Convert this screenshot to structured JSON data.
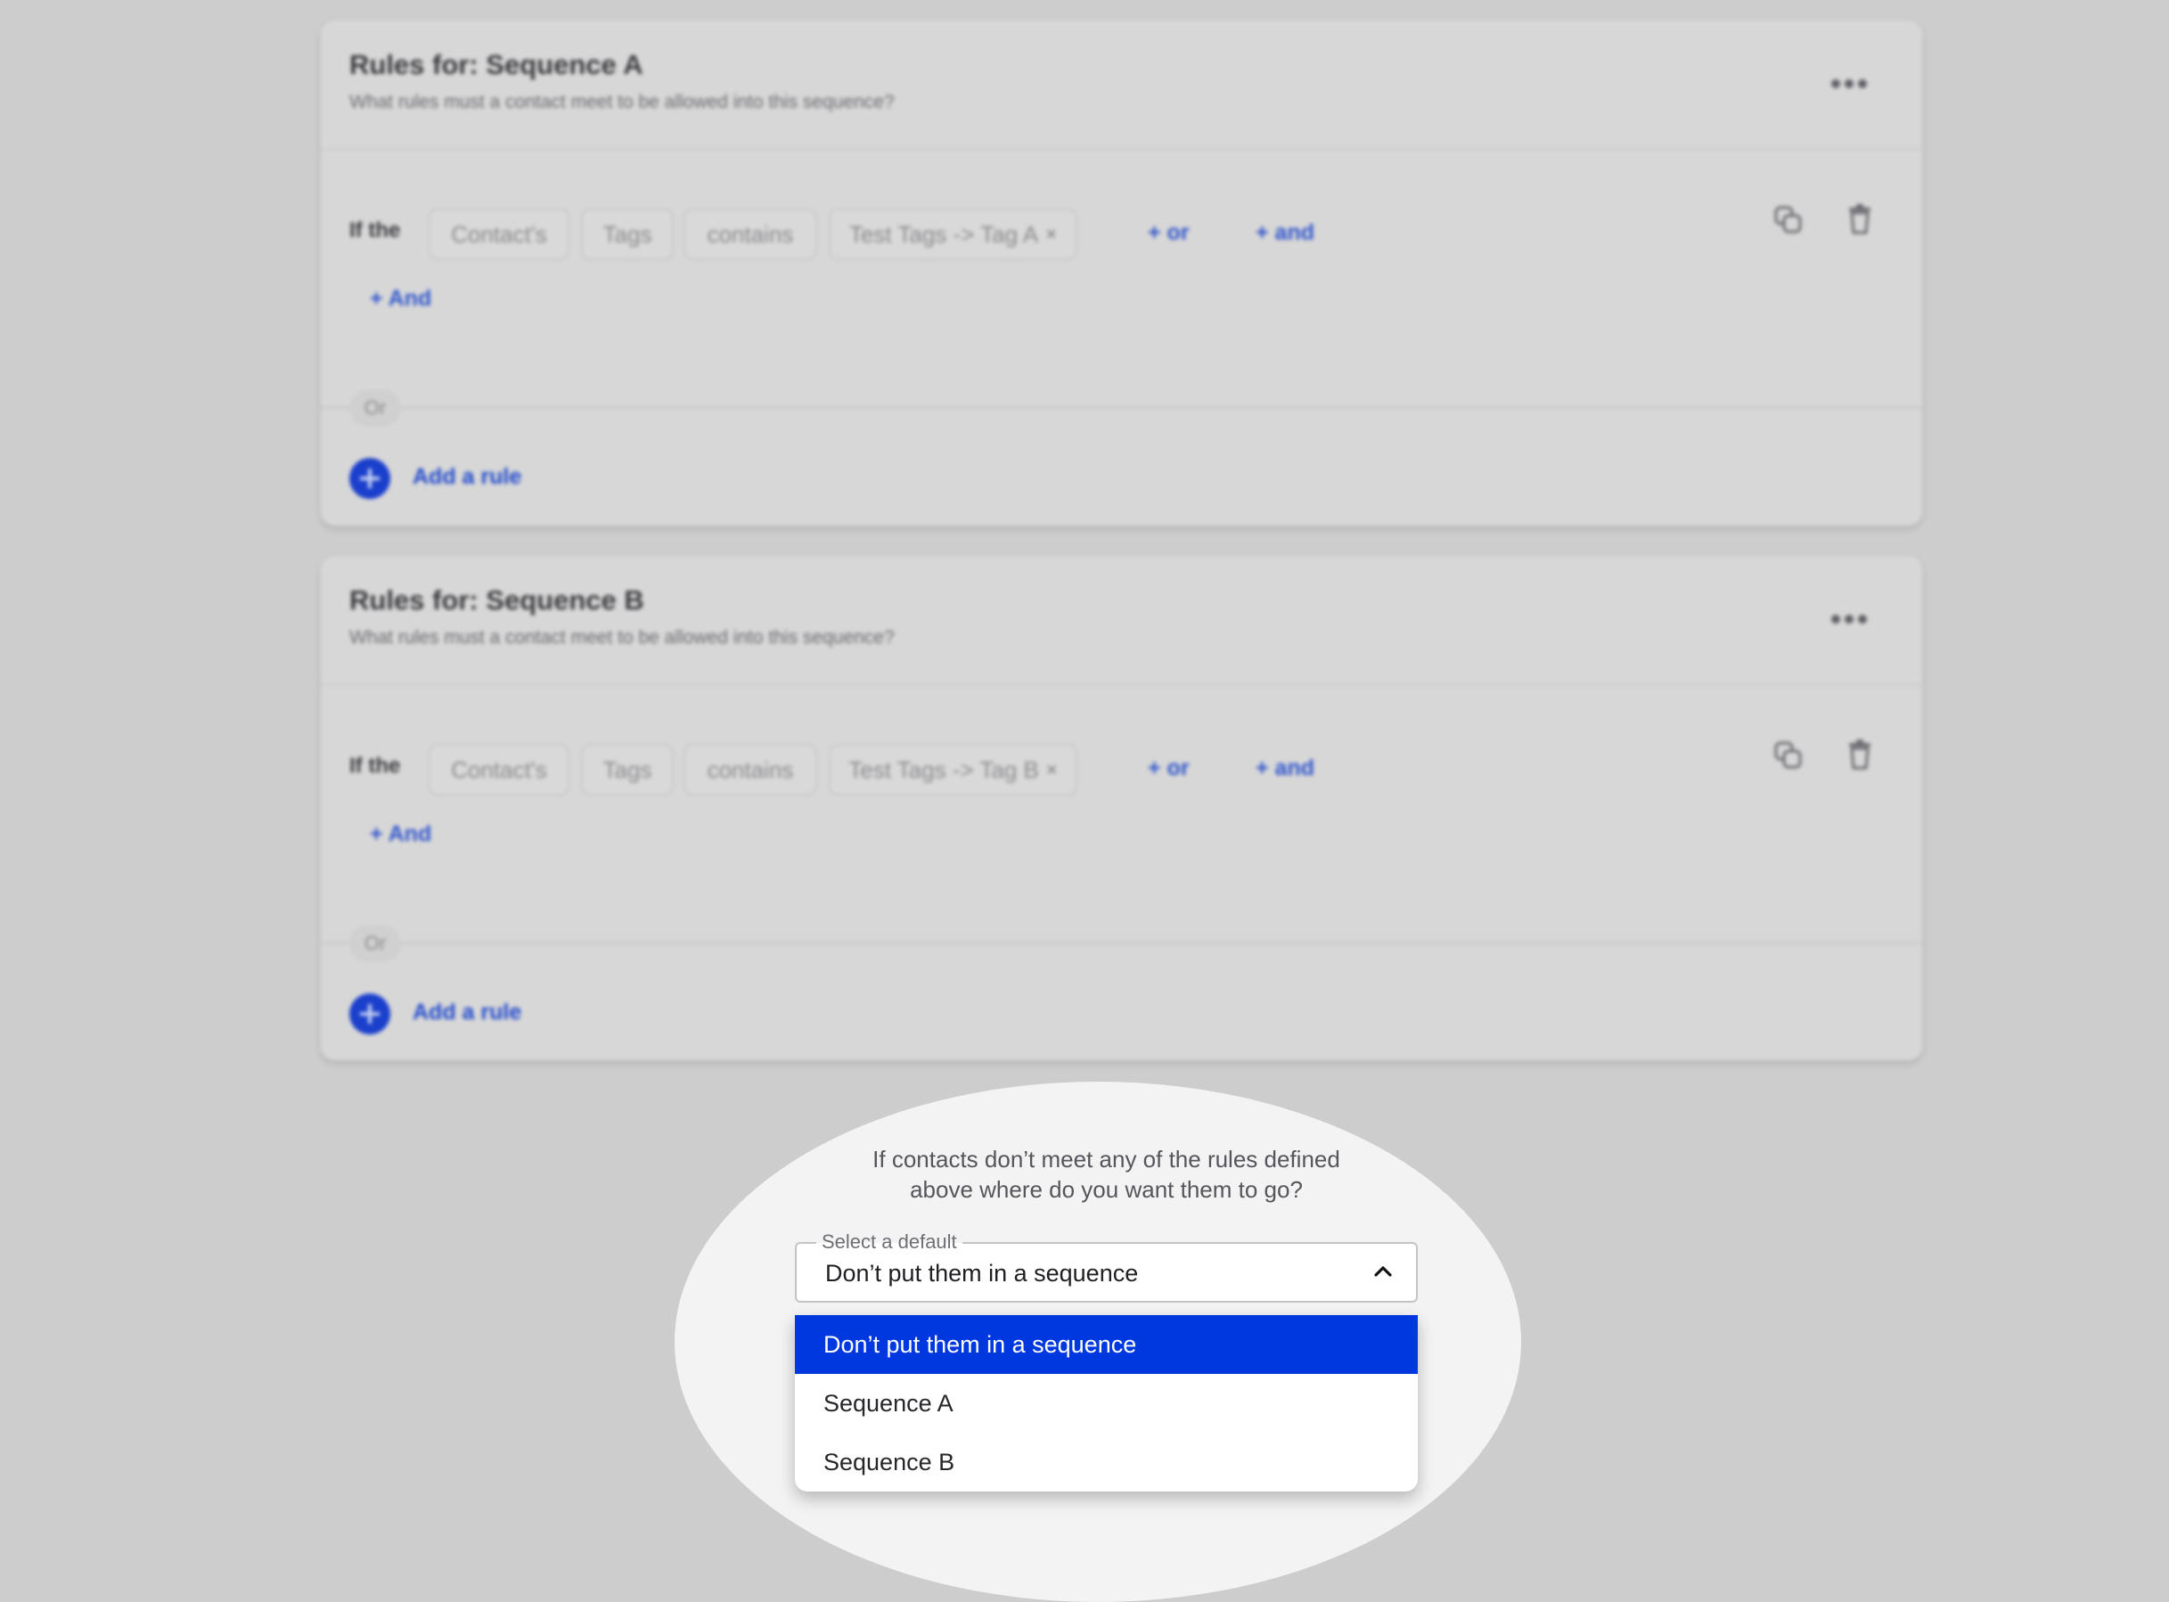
{
  "cards": [
    {
      "title": "Rules for: Sequence A",
      "subtitle": "What rules must a contact meet to be allowed into this sequence?",
      "rule": {
        "prefix": "If the",
        "subject": "Contact's",
        "field": "Tags",
        "operator": "contains",
        "value": "Test Tags -> Tag A",
        "remove_glyph": "×",
        "or_label": "+ or",
        "and_label": "+ and"
      },
      "and_label": "+ And",
      "or_separator": "Or",
      "add_rule_label": "Add a rule"
    },
    {
      "title": "Rules for: Sequence B",
      "subtitle": "What rules must a contact meet to be allowed into this sequence?",
      "rule": {
        "prefix": "If the",
        "subject": "Contact's",
        "field": "Tags",
        "operator": "contains",
        "value": "Test Tags -> Tag B",
        "remove_glyph": "×",
        "or_label": "+ or",
        "and_label": "+ and"
      },
      "and_label": "+ And",
      "or_separator": "Or",
      "add_rule_label": "Add a rule"
    }
  ],
  "default_section": {
    "question_line1": "If contacts don’t meet any of the rules defined",
    "question_line2": "above where do you want them to go?",
    "select_label": "Select a default",
    "selected_value": "Don’t put them in a sequence",
    "options": [
      {
        "label": "Don’t put them in a sequence",
        "selected": true
      },
      {
        "label": "Sequence A",
        "selected": false
      },
      {
        "label": "Sequence B",
        "selected": false
      }
    ]
  },
  "colors": {
    "accent_blue": "#0038e0",
    "link_blue": "#2f55cc",
    "background": "#cdcdcd",
    "card": "#d7d7d7"
  }
}
